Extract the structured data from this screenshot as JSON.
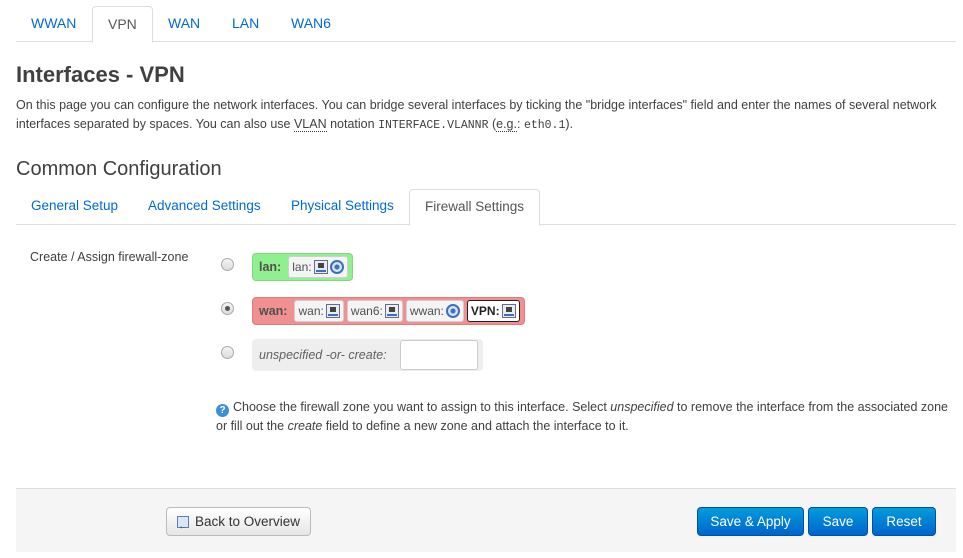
{
  "top_tabs": [
    {
      "label": "WWAN",
      "active": false
    },
    {
      "label": "VPN",
      "active": true
    },
    {
      "label": "WAN",
      "active": false
    },
    {
      "label": "LAN",
      "active": false
    },
    {
      "label": "WAN6",
      "active": false
    }
  ],
  "page": {
    "title": "Interfaces - VPN",
    "desc_part1": "On this page you can configure the network interfaces. You can bridge several interfaces by ticking the \"bridge interfaces\" field and enter the names of several network interfaces separated by spaces. You can also use ",
    "desc_vlan": "VLAN",
    "desc_part2": " notation ",
    "desc_code1": "INTERFACE.VLANNR",
    "desc_part3": " (",
    "desc_eg": "e.g.",
    "desc_part4": ": ",
    "desc_code2": "eth0.1",
    "desc_part5": ")."
  },
  "section": {
    "title": "Common Configuration",
    "tabs": [
      {
        "label": "General Setup",
        "active": false
      },
      {
        "label": "Advanced Settings",
        "active": false
      },
      {
        "label": "Physical Settings",
        "active": false
      },
      {
        "label": "Firewall Settings",
        "active": true
      }
    ]
  },
  "firewall": {
    "label": "Create / Assign firewall-zone",
    "zones": [
      {
        "name": "lan:",
        "color": "#90f090",
        "selected": false,
        "interfaces": [
          {
            "name": "lan:",
            "icons": [
              "ethernet-port-icon",
              "wifi-icon"
            ]
          }
        ]
      },
      {
        "name": "wan:",
        "color": "#f09090",
        "selected": true,
        "interfaces": [
          {
            "name": "wan:",
            "icons": [
              "ethernet-port-icon"
            ]
          },
          {
            "name": "wan6:",
            "icons": [
              "ethernet-port-icon"
            ]
          },
          {
            "name": "wwan:",
            "icons": [
              "wifi-icon"
            ]
          },
          {
            "name": "VPN:",
            "icons": [
              "ethernet-port-icon"
            ],
            "current": true
          }
        ]
      }
    ],
    "unspecified": {
      "label": "unspecified -or- create:",
      "value": "",
      "selected": false
    },
    "help": {
      "p1": "Choose the firewall zone you want to assign to this interface. Select ",
      "em1": "unspecified",
      "p2": " to remove the interface from the associated zone or fill out the ",
      "em2": "create",
      "p3": " field to define a new zone and attach the interface to it."
    }
  },
  "footer": {
    "back_label": "Back to Overview",
    "save_apply_label": "Save & Apply",
    "save_label": "Save",
    "reset_label": "Reset"
  },
  "colors": {
    "link": "#0069d6",
    "primary_button": "#0064cd",
    "lan_zone": "#90f090",
    "wan_zone": "#f09090"
  }
}
